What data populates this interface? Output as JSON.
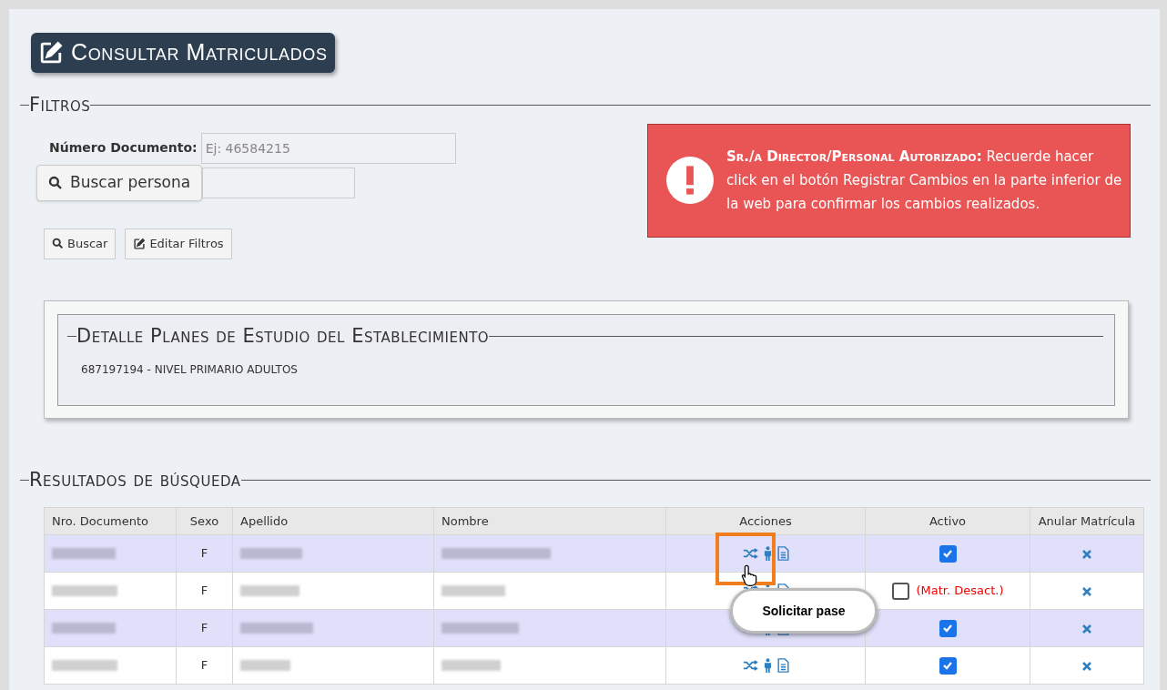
{
  "title": "Consultar Matriculados",
  "filters": {
    "legend": "Filtros",
    "document_label": "Número Documento:",
    "document_placeholder": "Ej: 46584215",
    "search_person_button": "Buscar persona",
    "buttons": [
      "Buscar",
      "Editar Filtros"
    ]
  },
  "alert": {
    "heading": "Sr./a Director/Personal Autorizado:",
    "text": "Recuerde hacer click en el botón Registrar Cambios en la parte inferior de la web para confirmar los cambios realizados."
  },
  "plans": {
    "legend": "Detalle Planes de Estudio del Establecimiento",
    "items": [
      "687197194 - NIVEL PRIMARIO ADULTOS"
    ]
  },
  "results": {
    "legend": "Resultados de búsqueda",
    "columns": [
      "Nro. Documento",
      "Sexo",
      "Apellido",
      "Nombre",
      "Acciones",
      "Activo",
      "Anular Matrícula"
    ],
    "rows": [
      {
        "sexo": "F",
        "active": true
      },
      {
        "sexo": "F",
        "active": false,
        "status": "(Matr. Desact.)"
      },
      {
        "sexo": "F",
        "active": true
      },
      {
        "sexo": "F",
        "active": true
      }
    ]
  },
  "tooltip": "Solicitar pase"
}
